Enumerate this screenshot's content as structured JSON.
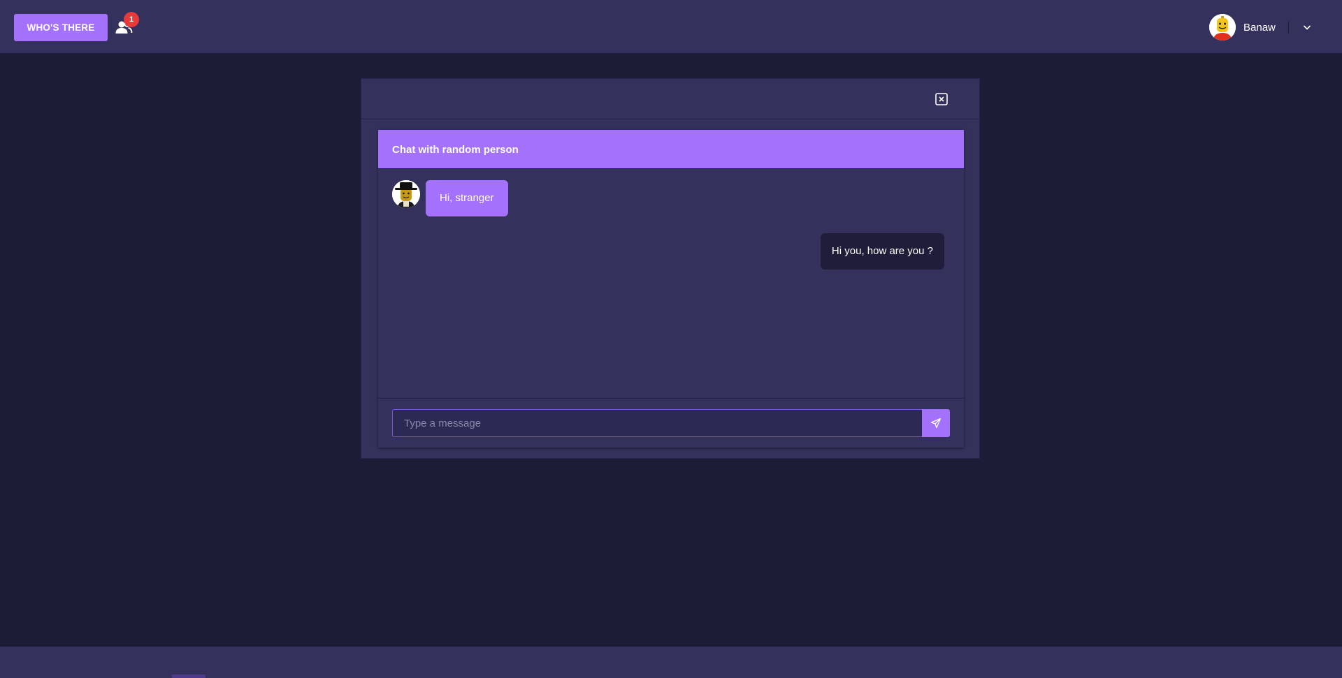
{
  "topbar": {
    "brand_label": "WHO'S THERE",
    "users_icon": "users-icon",
    "users_badge_count": "1",
    "user": {
      "name": "Banaw",
      "avatar_icon": "lego-minifigure-avatar"
    },
    "dropdown_icon": "chevron-down-icon"
  },
  "modal": {
    "close_icon": "close-box-icon",
    "chat": {
      "title": "Chat with random person",
      "messages": [
        {
          "direction": "incoming",
          "text": "Hi, stranger",
          "avatar_icon": "lego-minifigure-hat-avatar"
        },
        {
          "direction": "outgoing",
          "text": "Hi you, how are you ?"
        }
      ],
      "input_placeholder": "Type a message",
      "input_value": "",
      "send_icon": "send-icon"
    }
  },
  "colors": {
    "accent": "#a371fc",
    "background": "#1d1c37",
    "panel": "#34325c",
    "badge": "#e83a3a"
  }
}
